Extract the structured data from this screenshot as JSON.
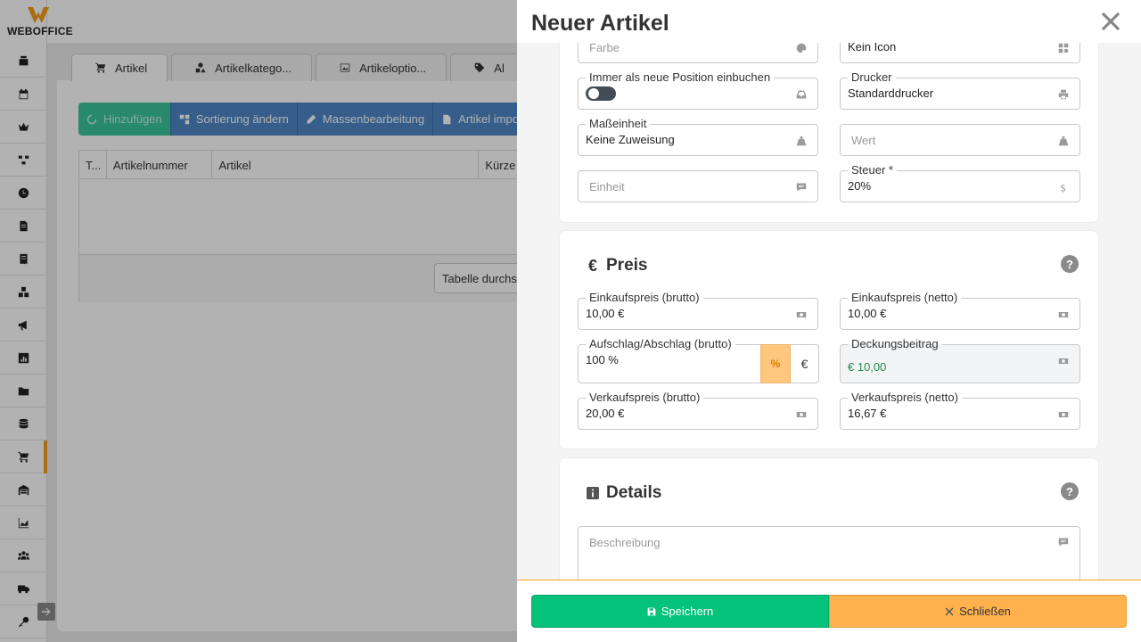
{
  "app": {
    "logo_text": "WEBOFFICE"
  },
  "background": {
    "tabs": [
      {
        "label": "Artikel"
      },
      {
        "label": "Artikelkatego..."
      },
      {
        "label": "Artikeloptio..."
      },
      {
        "label": "Al"
      }
    ],
    "toolbar": {
      "add_label": "Hinzufügen",
      "sort_label": "Sortierung ändern",
      "bulk_label": "Massenbearbeitung",
      "import_label": "Artikel impo"
    },
    "table": {
      "columns": [
        "T...",
        "Artikelnummer",
        "Artikel",
        "Kürze"
      ],
      "search_label": "Tabelle durchs"
    }
  },
  "drawer": {
    "title": "Neuer Artikel",
    "general": {
      "farbe_placeholder": "Farbe",
      "icon_value": "Kein Icon",
      "position_label": "Immer als neue Position einbuchen",
      "drucker_label": "Drucker",
      "drucker_value": "Standarddrucker",
      "masseinheit_label": "Maßeinheit",
      "masseinheit_value": "Keine Zuweisung",
      "wert_placeholder": "Wert",
      "einheit_placeholder": "Einheit",
      "steuer_label": "Steuer *",
      "steuer_value": "20%"
    },
    "preis": {
      "title": "Preis",
      "help": "?",
      "ek_brutto_label": "Einkaufspreis (brutto)",
      "ek_brutto_value": "10,00 €",
      "ek_netto_label": "Einkaufspreis (netto)",
      "ek_netto_value": "10,00 €",
      "aufschlag_label": "Aufschlag/Abschlag (brutto)",
      "aufschlag_value": "100 %",
      "pct_symbol": "%",
      "eur_symbol": "€",
      "deckung_label": "Deckungsbeitrag",
      "deckung_value": "€ 10,00",
      "vk_brutto_label": "Verkaufspreis (brutto)",
      "vk_brutto_value": "20,00 €",
      "vk_netto_label": "Verkaufspreis (netto)",
      "vk_netto_value": "16,67 €"
    },
    "details": {
      "title": "Details",
      "help": "?",
      "beschreibung_placeholder": "Beschreibung"
    },
    "footer": {
      "save_label": "Speichern",
      "close_label": "Schließen"
    }
  },
  "colors": {
    "save": "#05c27b",
    "close": "#ffb14e",
    "accent": "#f0a020",
    "toolbar_blue": "#4f86c6"
  }
}
